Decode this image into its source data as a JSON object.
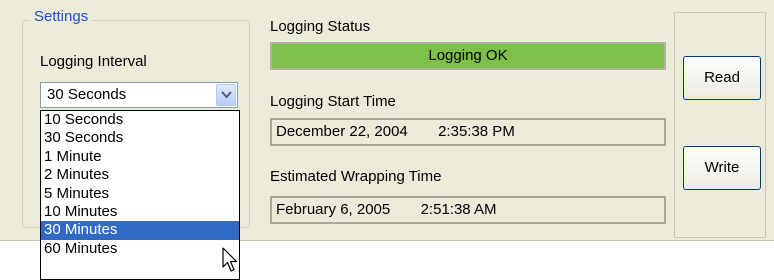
{
  "settings": {
    "legend": "Settings",
    "interval_label": "Logging Interval",
    "interval_selected": "30 Seconds",
    "options": [
      "10 Seconds",
      "30 Seconds",
      "1 Minute",
      "2 Minutes",
      "5 Minutes",
      "10 Minutes",
      "30 Minutes",
      "60 Minutes"
    ],
    "highlighted_option": "30 Minutes"
  },
  "status": {
    "label": "Logging Status",
    "value": "Logging OK",
    "color": "#7ec04a"
  },
  "start_time": {
    "label": "Logging Start Time",
    "date": "December 22, 2004",
    "time": "2:35:38 PM"
  },
  "wrap_time": {
    "label": "Estimated Wrapping Time",
    "date": "February 6, 2005",
    "time": "2:51:38 AM"
  },
  "buttons": {
    "read": "Read",
    "write": "Write"
  }
}
